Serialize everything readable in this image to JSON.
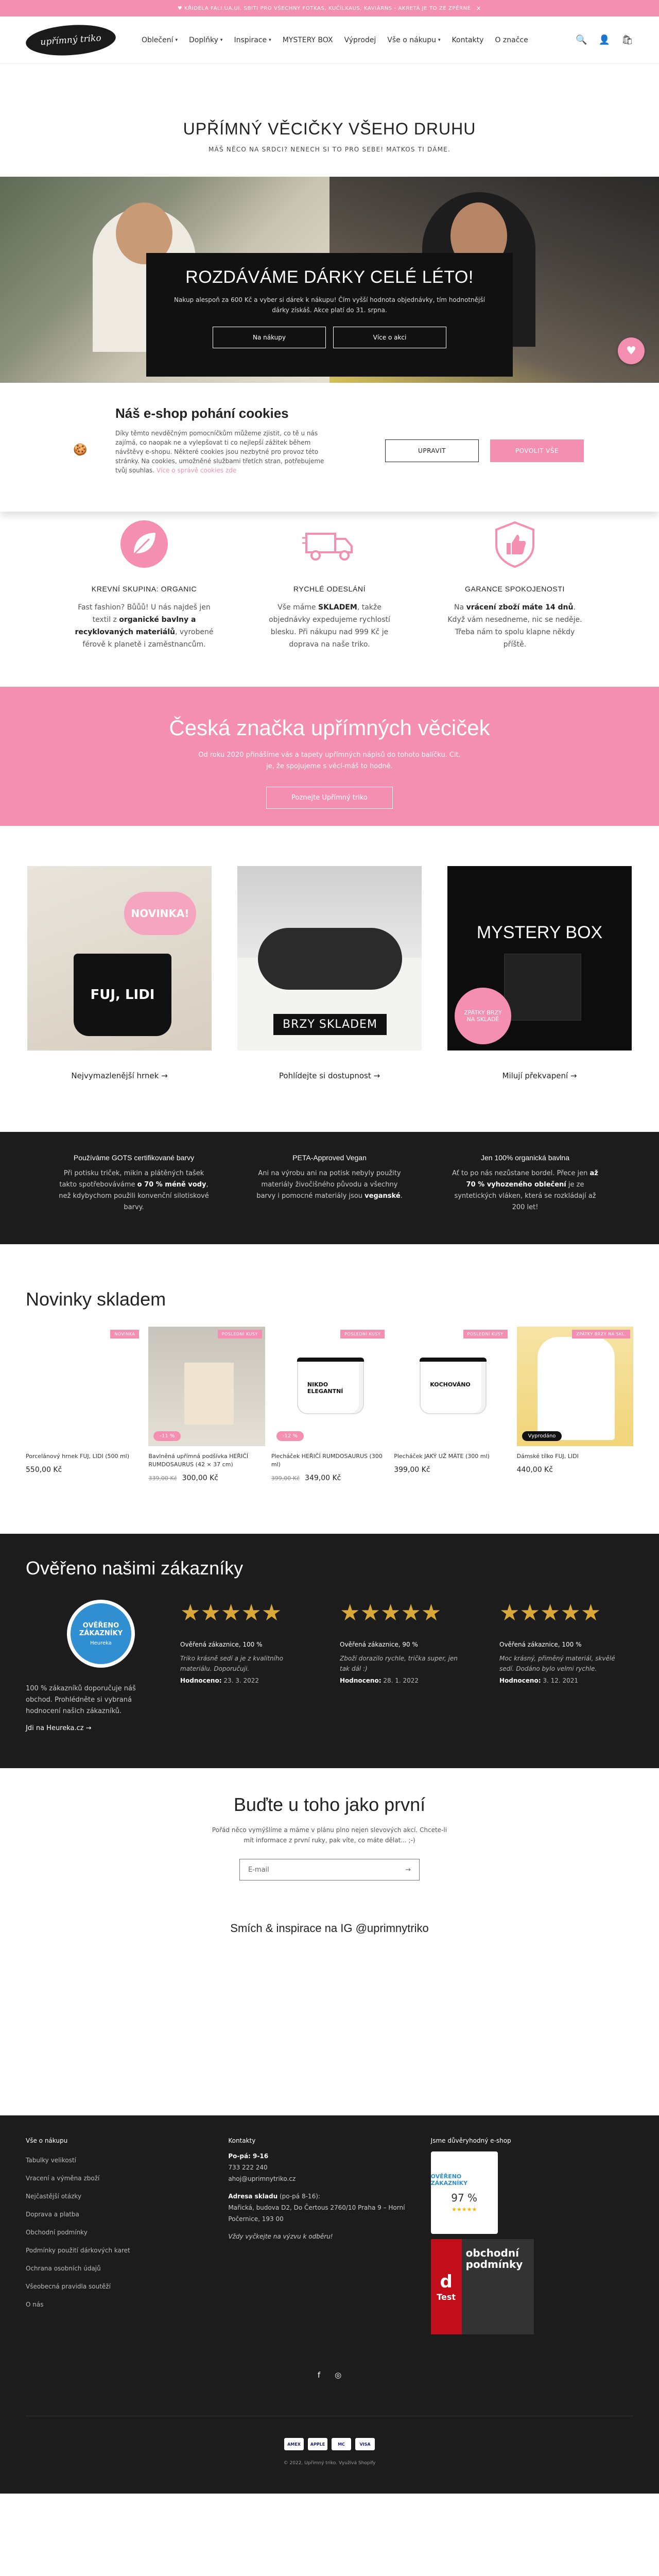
{
  "announcement": {
    "text": "♥ KŘIDÉLA FALI.UA.UI. SBITI PRO VŠECHNY FOTKAS, KUČÍLKAUS, KAVIÁRNS - AKRETÁ JE TO ZE ZPĚRNÉ",
    "close": "×"
  },
  "header": {
    "logo": "upřímný triko",
    "nav": [
      "Oblečení",
      "Doplňky",
      "Inspirace",
      "MYSTERY BOX",
      "Výprodej",
      "Vše o nákupu",
      "Kontakty",
      "O značce"
    ],
    "nav_has_menu": [
      true,
      true,
      true,
      false,
      false,
      true,
      false,
      false
    ],
    "icons": {
      "search": "🔍",
      "account": "👤",
      "cart": "🛍"
    }
  },
  "hero": {
    "title": "UPŘÍMNÝ VĚCIČKY VŠEHO DRUHU",
    "subtitle": "MÁŠ NĚCO NA SRDCI? NENECH SI TO PRO SEBE! MATKOS TI DÁME."
  },
  "banner": {
    "title": "ROZDÁVÁME DÁRKY CELÉ LÉTO!",
    "text": "Nakup alespoň za 600 Kč a vyber si dárek k nákupu! Čím vyšší hodnota objednávky, tím hodnotnější dárky získáš. Akce platí do 31. srpna.",
    "btn1": "Na nákupy",
    "btn2": "Více o akci",
    "chat_icon": "♥"
  },
  "cookie": {
    "title": "Náš e-shop pohání cookies",
    "text": "Díky těmto nevděčným pomocníčkům můžeme zjistit, co tě u nás zajímá, co naopak ne a vylepšovat ti co nejlepší zážitek během návštěvy e-shopu. Některé cookies jsou nezbytné pro provoz této stránky. Na cookies, umožněné službami třetích stran, potřebujeme tvůj souhlas.",
    "link": "Více o správě cookies zde",
    "btn_adjust": "UPRAVIT",
    "btn_allow": "POVOLIT VŠE",
    "icon": "🍪"
  },
  "features": [
    {
      "title": "KREVNÍ SKUPINA: ORGANIC",
      "text_pre": "Fast fashion? Bůůů! U nás najdeš jen textil z ",
      "bold": "organické bavlny a recyklovaných materiálů",
      "text_post": ", vyrobené férově k planetě i zaměstnancům."
    },
    {
      "title": "RYCHLÉ ODESLÁNÍ",
      "text_pre": "Vše máme ",
      "bold": "SKLADEM",
      "text_post": ", takže objednávky expedujeme rychlostí blesku. Při nákupu nad 999 Kč je doprava na naše triko."
    },
    {
      "title": "GARANCE SPOKOJENOSTI",
      "text_pre": "Na ",
      "bold": "vrácení zboží máte 14 dnů",
      "text_post": ". Když vám nesedneme, nic se neděje. Třeba nám to spolu klapne někdy příště."
    }
  ],
  "brand": {
    "title": "Česká značka upřímných věciček",
    "text": "Od roku 2020 přinášíme vás a tapety upřímných nápisů do tohoto balíčku. Cit. je, že spojujeme s věcí-máš to hodně.",
    "button": "Poznejte Upřímný triko"
  },
  "collections": [
    {
      "label": "Nejvymazlenější hrnek",
      "img_text": "FUJ, LIDI",
      "badge": "NOVINKA!"
    },
    {
      "label": "Pohlídejte si dostupnost",
      "img_text": "BRZY SKLADEM",
      "badge": ""
    },
    {
      "label": "Milují překvapení",
      "img_text": "MYSTERY BOX",
      "badge": "ZPÁTKY BRZY NA SKLADĚ"
    }
  ],
  "values": [
    {
      "title": "Používáme GOTS certifikované barvy",
      "pre": "Při potisku triček, mikin a plátěných tašek takto spotřebováváme ",
      "bold": "o 70 % méně vody",
      "post": ", než kdybychom použili konvenční silotiskové barvy."
    },
    {
      "title": "PETA-Approved Vegan",
      "pre": "Ani na výrobu ani na potisk nebyly použity materiály živočišného původu a všechny barvy i pomocné materiály jsou ",
      "bold": "veganské",
      "post": "."
    },
    {
      "title": "Jen 100% organická bavlna",
      "pre": "Ať to po nás nezůstane bordel. Přece jen ",
      "bold": "až 70 % vyhozeného oblečení",
      "post": " je ze syntetických vláken, která se rozkládají až 200 let!"
    }
  ],
  "new_products": {
    "title": "Novinky skladem",
    "items": [
      {
        "tag": "NOVINKA",
        "img_text": "FUJ, LIDI",
        "name": "Porcelánový hrnek FUJ, LIDI (500 ml)",
        "old_price": "",
        "price": "550,00 Kč",
        "flag": ""
      },
      {
        "tag": "POSLEDNÍ KUSY",
        "img_text": "",
        "name": "Bavlněná upřímná podšívka HEŘIČÍ RUMDOSAURUS (42 × 37 cm)",
        "old_price": "339,00 Kč",
        "price": "300,00 Kč",
        "flag": "-11 %"
      },
      {
        "tag": "POSLEDNÍ KUSY",
        "img_text": "NIKDO ELEGANTNÍ",
        "name": "Plecháček HEŘIČÍ RUMDOSAURUS (300 ml)",
        "old_price": "399,00 Kč",
        "price": "349,00 Kč",
        "flag": "-12 %"
      },
      {
        "tag": "POSLEDNÍ KUSY",
        "img_text": "KOCHOVÁNO",
        "name": "Plecháček JAKÝ UŽ MÁTE (300 ml)",
        "old_price": "",
        "price": "399,00 Kč",
        "flag": ""
      },
      {
        "tag": "ZPÁTKY BRZY NA SKL.",
        "img_text": "FUJ, LIDI",
        "name": "Dámské tílko FUJ, LIDI",
        "old_price": "",
        "price": "440,00 Kč",
        "flag": "Vyprodáno"
      }
    ]
  },
  "reviews": {
    "title": "Ověřeno našimi zákazníky",
    "heureka": {
      "badge_line1": "OVĚŘENO",
      "badge_line2": "ZÁKAZNÍKY",
      "badge_line3": "Heureka",
      "text": "100 % zákazníků doporučuje náš obchod. Prohlédněte si vybraná hodnocení našich zákazníků.",
      "link": "Jdi na Heureka.cz"
    },
    "items": [
      {
        "title": "Ověřená zákaznice, 100 %",
        "quote": "Triko krásně sedí a je z kvalitního materiálu. Doporučuji.",
        "date_label": "Hodnoceno:",
        "date": "23. 3. 2022"
      },
      {
        "title": "Ověřená zákaznice, 90 %",
        "quote": "Zboží dorazilo rychle, trička super, jen tak dál :)",
        "date_label": "Hodnoceno:",
        "date": "28. 1. 2022"
      },
      {
        "title": "Ověřená zákaznice, 100 %",
        "quote": "Moc krásný, přiměný materiál, skvělé sedí. Dodáno bylo velmi rychle.",
        "date_label": "Hodnoceno:",
        "date": "3. 12. 2021"
      }
    ]
  },
  "newsletter": {
    "title": "Buďte u toho jako první",
    "text": "Pořád něco vymýšlíme a máme v plánu plno nejen slevových akcí. Chcete-li mít informace z první ruky, pak víte, co máte dělat... ;-)",
    "placeholder": "E-mail"
  },
  "instagram": {
    "title": "Smích & inspirace na IG @uprimnytriko"
  },
  "footer": {
    "col1": {
      "title": "Vše o nákupu",
      "links": [
        "Tabulky velikostí",
        "Vracení a výměna zboží",
        "Nejčastější otázky",
        "Doprava a platba",
        "Obchodní podmínky",
        "Podmínky použití dárkových karet",
        "Ochrana osobních údajů",
        "Všeobecná pravidla soutěží",
        "O nás"
      ]
    },
    "col2": {
      "title": "Kontakty",
      "hours": "Po-pá: 9-16",
      "phone": "733 222 240",
      "email": "ahoj@uprimnytriko.cz",
      "addr_title": "Adresa skladu",
      "addr_hours": "(po-pá 8-16):",
      "address": "Mařická, budova D2, Do Čertous 2760/10 Praha 9 – Horní Počernice, 193 00",
      "note": "Vždy vyčkejte na výzvu k odběru!"
    },
    "col3": {
      "title": "Jsme důvěryhodný e-shop",
      "heureka": "OVĚŘENO ZÁKAZNÍKY",
      "percent": "97 %",
      "dtest1": "d",
      "dtest2": "Test",
      "dtest_text": "obchodní podmínky"
    },
    "social": [
      "f",
      "◎"
    ],
    "payments": [
      "AMEX",
      "APPLE",
      "MC",
      "VISA"
    ],
    "copyright": "© 2022, Upřímný triko. Využívá Shopify"
  }
}
